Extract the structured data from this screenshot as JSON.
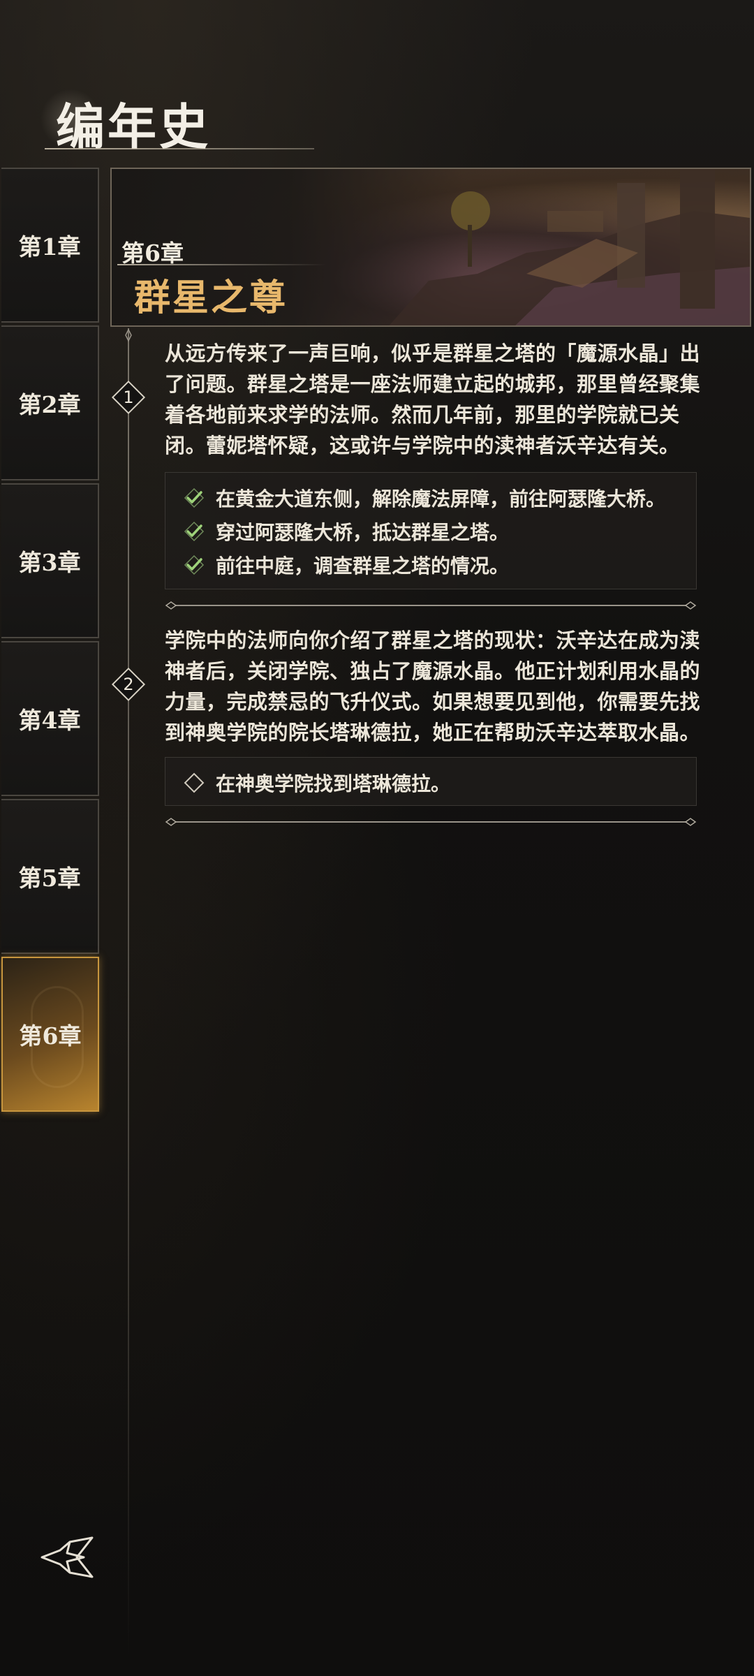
{
  "header": {
    "title": "编年史"
  },
  "sidebar": {
    "tabs": [
      {
        "label": "第1章"
      },
      {
        "label": "第2章"
      },
      {
        "label": "第3章"
      },
      {
        "label": "第4章"
      },
      {
        "label": "第5章"
      },
      {
        "label": "第6章",
        "active": true
      }
    ]
  },
  "chapter": {
    "number": "第6章",
    "title": "群星之尊"
  },
  "quests": [
    {
      "index": "1",
      "description": "从远方传来了一声巨响，似乎是群星之塔的「魔源水晶」出了问题。群星之塔是一座法师建立起的城邦，那里曾经聚集着各地前来求学的法师。然而几年前，那里的学院就已关闭。蕾妮塔怀疑，这或许与学院中的渎神者沃辛达有关。",
      "objectives": [
        {
          "text": "在黄金大道东侧，解除魔法屏障，前往阿瑟隆大桥。",
          "status": "completed",
          "icon": "check-icon"
        },
        {
          "text": "穿过阿瑟隆大桥，抵达群星之塔。",
          "status": "completed",
          "icon": "check-icon"
        },
        {
          "text": "前往中庭，调查群星之塔的情况。",
          "status": "completed",
          "icon": "check-icon"
        }
      ]
    },
    {
      "index": "2",
      "description": "学院中的法师向你介绍了群星之塔的现状：沃辛达在成为渎神者后，关闭学院、独占了魔源水晶。他正计划利用水晶的力量，完成禁忌的飞升仪式。如果想要见到他，你需要先找到神奥学院的院长塔琳德拉，她正在帮助沃辛达萃取水晶。",
      "objectives": [
        {
          "text": "在神奥学院找到塔琳德拉。",
          "status": "pending",
          "icon": "diamond-outline-icon"
        }
      ]
    }
  ],
  "colors": {
    "accent_gold": "#e8b86c",
    "active_tab": "#b8842e",
    "check_green": "#8ad06a",
    "text": "#ece6d9"
  }
}
